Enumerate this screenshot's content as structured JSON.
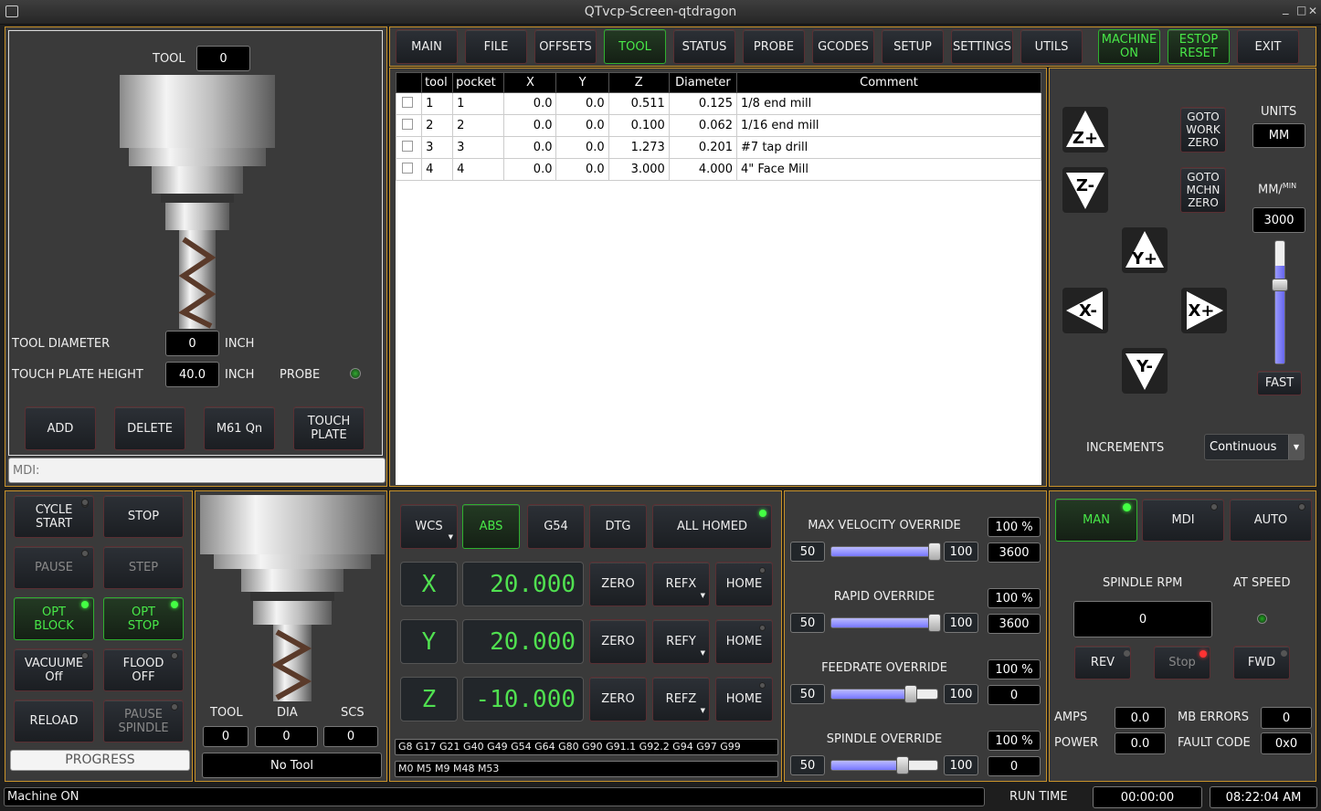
{
  "window": {
    "title": "QTvcp-Screen-qtdragon",
    "min": "_",
    "max": "□",
    "close": "✕"
  },
  "nav": [
    "MAIN",
    "FILE",
    "OFFSETS",
    "TOOL",
    "STATUS",
    "PROBE",
    "GCODES",
    "SETUP",
    "SETTINGS",
    "UTILS"
  ],
  "machine_on": "MACHINE\nON",
  "estop": "ESTOP\nRESET",
  "exit": "EXIT",
  "toolpanel": {
    "tool_label": "TOOL",
    "tool_value": "0",
    "diam_label": "TOOL DIAMETER",
    "diam_value": "0",
    "diam_unit": "INCH",
    "plate_label": "TOUCH PLATE HEIGHT",
    "plate_value": "40.0",
    "plate_unit": "INCH",
    "probe_label": "PROBE",
    "add": "ADD",
    "delete": "DELETE",
    "m61": "M61 Qn",
    "touch": "TOUCH\nPLATE"
  },
  "mdi_placeholder": "MDI:",
  "tooltable": {
    "headers": [
      "",
      "tool",
      "pocket",
      "X",
      "Y",
      "Z",
      "Diameter",
      "Comment"
    ],
    "rows": [
      [
        "1",
        "1",
        "0.0",
        "0.0",
        "0.511",
        "0.125",
        "1/8 end mill"
      ],
      [
        "2",
        "2",
        "0.0",
        "0.0",
        "0.100",
        "0.062",
        "1/16 end mill"
      ],
      [
        "3",
        "3",
        "0.0",
        "0.0",
        "1.273",
        "0.201",
        "#7 tap drill"
      ],
      [
        "4",
        "4",
        "0.0",
        "0.0",
        "3.000",
        "4.000",
        "4\" Face Mill"
      ]
    ]
  },
  "jog": {
    "zp": "Z+",
    "zm": "Z-",
    "yp": "Y+",
    "ym": "Y-",
    "xp": "X+",
    "xm": "X-",
    "goto_work": "GOTO\nWORK\nZERO",
    "goto_mchn": "GOTO\nMCHN\nZERO",
    "units_label": "UNITS",
    "units": "MM",
    "rate_label": "MM/",
    "rate_sup": "MIN",
    "rate": "3000",
    "fast": "FAST",
    "slider_level": 0.8,
    "increments_label": "INCREMENTS",
    "increments": "Continuous"
  },
  "controls": {
    "cycle_start": "CYCLE\nSTART",
    "stop": "STOP",
    "pause": "PAUSE",
    "step": "STEP",
    "opt_block": "OPT\nBLOCK",
    "opt_stop": "OPT\nSTOP",
    "vacuum": "VACUUME\nOff",
    "flood": "FLOOD\nOFF",
    "reload": "RELOAD",
    "pause_spindle": "PAUSE\nSPINDLE",
    "progress": "PROGRESS"
  },
  "toolinfo": {
    "tool_label": "TOOL",
    "dia_label": "DIA",
    "scs_label": "SCS",
    "tool": "0",
    "dia": "0",
    "scs": "0",
    "name": "No Tool"
  },
  "dro": {
    "wcs": "WCS",
    "abs": "ABS",
    "g54": "G54",
    "dtg": "DTG",
    "homed": "ALL HOMED",
    "axes": [
      {
        "name": "X",
        "value": "20.000",
        "ref": "REFX"
      },
      {
        "name": "Y",
        "value": "20.000",
        "ref": "REFY"
      },
      {
        "name": "Z",
        "value": "-10.000",
        "ref": "REFZ"
      }
    ],
    "zero": "ZERO",
    "home": "HOME",
    "gcodes": "G8 G17 G21 G40 G49 G54 G64 G80 G90 G91.1 G92.2 G94 G97 G99",
    "mcodes": "M0 M5 M9 M48 M53"
  },
  "overrides": [
    {
      "label": "MAX VELOCITY OVERRIDE",
      "min": "50",
      "max": "100",
      "pct": "100 %",
      "val": "3600",
      "level": 1.0
    },
    {
      "label": "RAPID OVERRIDE",
      "min": "50",
      "max": "100",
      "pct": "100 %",
      "val": "3600",
      "level": 1.0
    },
    {
      "label": "FEEDRATE OVERRIDE",
      "min": "50",
      "max": "100",
      "pct": "100 %",
      "val": "0",
      "level": 0.76
    },
    {
      "label": "SPINDLE OVERRIDE",
      "min": "50",
      "max": "100",
      "pct": "100 %",
      "val": "0",
      "level": 0.68
    }
  ],
  "spindle": {
    "man": "MAN",
    "mdi": "MDI",
    "auto": "AUTO",
    "rpm_label": "SPINDLE RPM",
    "atspeed_label": "AT SPEED",
    "rpm": "0",
    "rev": "REV",
    "stop": "Stop",
    "fwd": "FWD",
    "amps_label": "AMPS",
    "amps": "0.0",
    "mberr_label": "MB ERRORS",
    "mberr": "0",
    "power_label": "POWER",
    "power": "0.0",
    "fault_label": "FAULT CODE",
    "fault": "0x0"
  },
  "status": {
    "message": "Machine ON",
    "runtime_label": "RUN TIME",
    "runtime": "00:00:00",
    "clock": "08:22:04 AM"
  }
}
